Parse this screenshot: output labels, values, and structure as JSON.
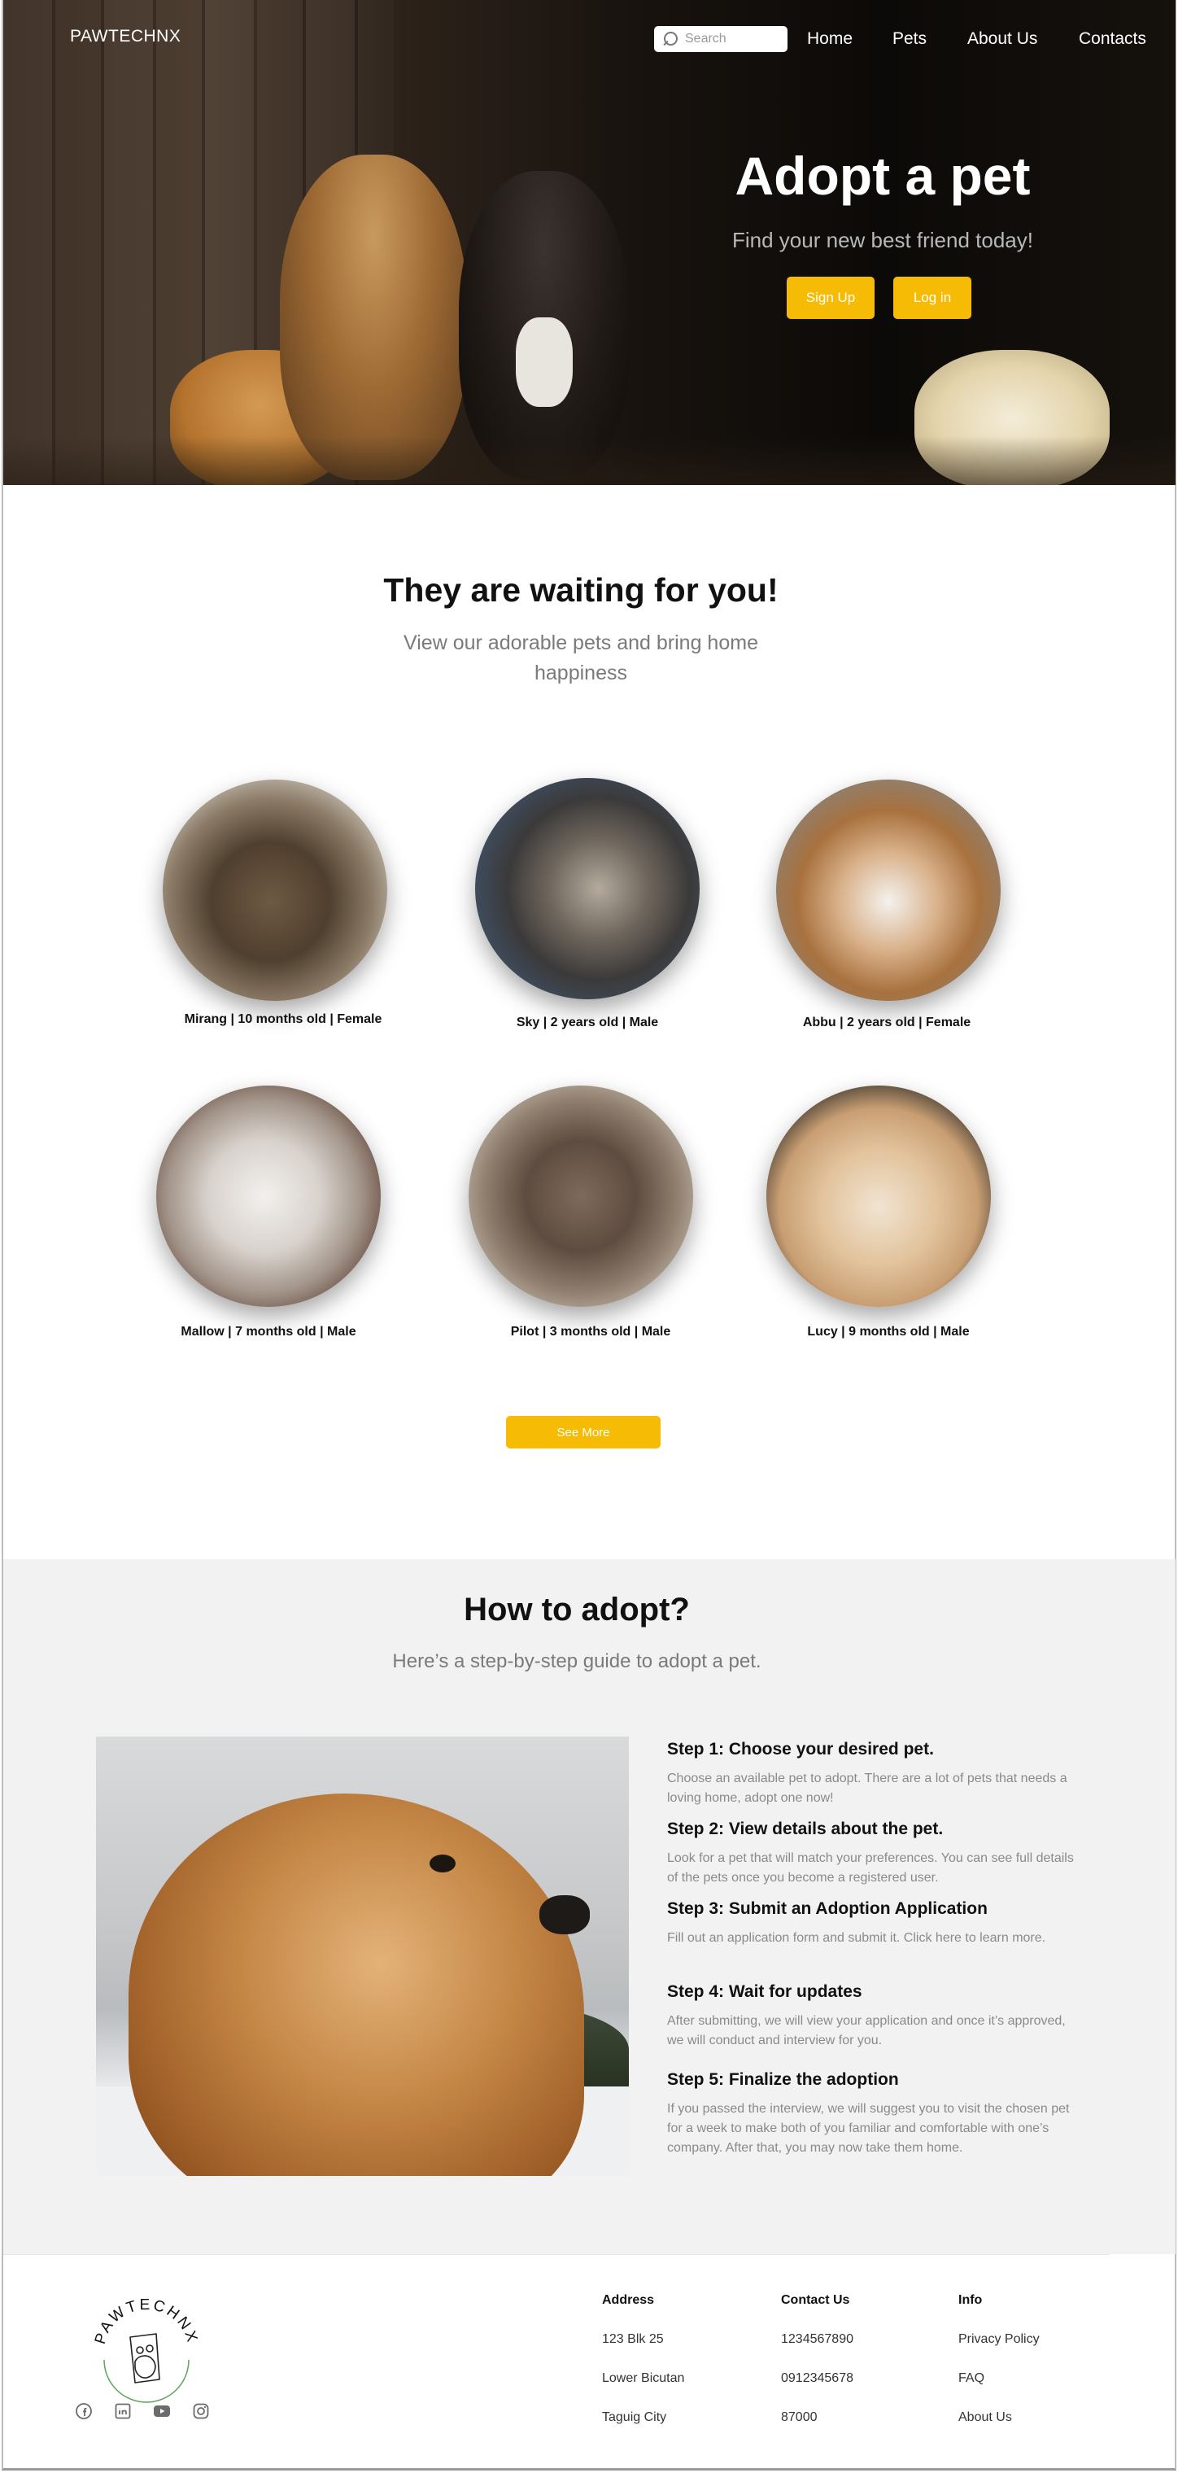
{
  "header": {
    "brand": "PAWTECHNX",
    "search": {
      "placeholder": "Search"
    },
    "nav": [
      "Home",
      "Pets",
      "About Us",
      "Contacts"
    ]
  },
  "hero": {
    "title": "Adopt a pet",
    "subtitle": "Find your new best friend today!",
    "signup_label": "Sign Up",
    "login_label": "Log in"
  },
  "waiting": {
    "title": "They are waiting for you!",
    "subtitle": "View our adorable pets and bring home happiness",
    "pets": [
      {
        "label": "Mirang |  10 months old | Female"
      },
      {
        "label": "Sky | 2 years old | Male"
      },
      {
        "label": "Abbu | 2 years old | Female"
      },
      {
        "label": "Mallow | 7 months old | Male"
      },
      {
        "label": "Pilot | 3 months old | Male"
      },
      {
        "label": "Lucy | 9 months old | Male"
      }
    ],
    "see_more_label": "See More"
  },
  "how": {
    "title": "How to adopt?",
    "subtitle": "Here’s a step-by-step guide to adopt a pet.",
    "steps": [
      {
        "title": "Step 1: Choose your desired pet.",
        "text": "Choose an available pet to adopt. There are a lot of pets that needs a loving home, adopt one now!"
      },
      {
        "title": "Step 2: View details about the pet.",
        "text": "Look for a pet that will match your preferences. You can see full details of the pets once you become a registered user."
      },
      {
        "title": "Step 3: Submit an Adoption Application",
        "text": "Fill out an application form and submit it. Click here to learn more."
      },
      {
        "title": "Step 4: Wait for updates",
        "text": "After submitting, we will view your application and once it’s approved, we will conduct and interview for you."
      },
      {
        "title": "Step 5: Finalize the adoption",
        "text": "If you passed the interview, we will suggest you to visit the chosen pet for a week to make both of you familiar and comfortable with one’s company. After that, you may now take them home."
      }
    ]
  },
  "footer": {
    "logo_text": "PAWTECHNX",
    "address": {
      "heading": "Address",
      "lines": [
        "123 Blk 25",
        "Lower Bicutan",
        "Taguig City"
      ]
    },
    "contact": {
      "heading": "Contact Us",
      "lines": [
        "1234567890",
        "0912345678",
        "87000"
      ]
    },
    "info": {
      "heading": "Info",
      "links": [
        "Privacy Policy",
        "FAQ",
        "About Us"
      ]
    },
    "social_icons": [
      "facebook-icon",
      "linkedin-icon",
      "youtube-icon",
      "instagram-icon"
    ]
  },
  "colors": {
    "accent": "#f6bc05",
    "section_bg": "#f2f2f2",
    "logo_green": "#5aa55a"
  }
}
